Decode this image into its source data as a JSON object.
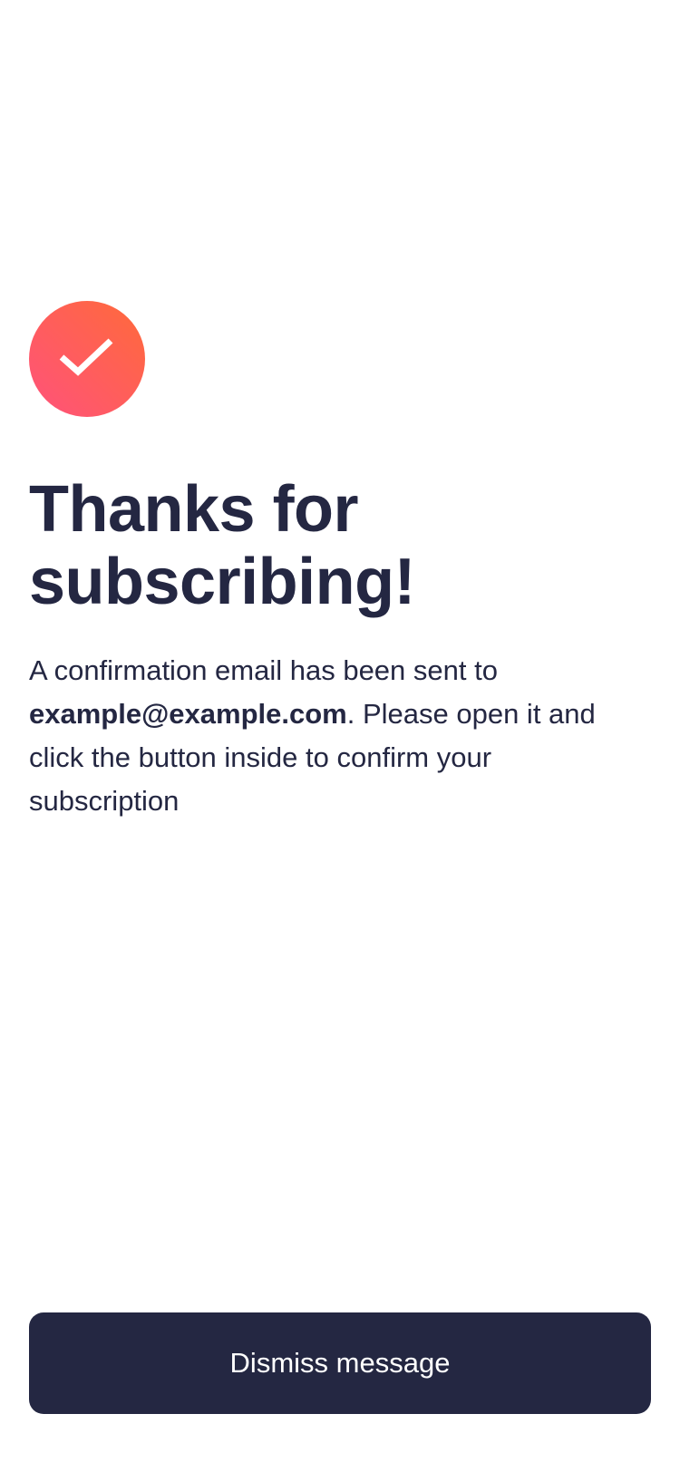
{
  "icon": {
    "name": "checkmark-icon",
    "gradient_start": "#FF6A3A",
    "gradient_end": "#FF527B"
  },
  "title": {
    "line1": "Thanks for",
    "line2": "subscribing!"
  },
  "message": {
    "prefix": "A confirmation email has been sent to ",
    "email": "example@example.com",
    "suffix": ". Please open it and click the button inside to confirm your subscription"
  },
  "dismiss_button": {
    "label": "Dismiss message",
    "color": "#242742"
  }
}
